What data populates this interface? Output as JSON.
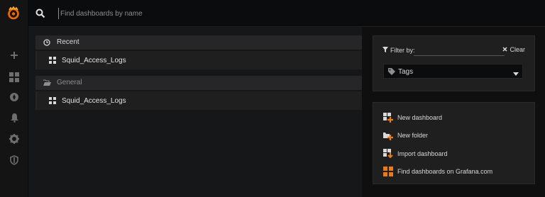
{
  "search": {
    "placeholder": "Find dashboards by name"
  },
  "sidenav": {
    "items": [
      "grafana-logo-icon",
      "plus-icon",
      "grid-icon",
      "compass-icon",
      "bell-icon",
      "gear-icon",
      "shield-icon"
    ]
  },
  "sections": [
    {
      "title": "Recent",
      "icon": "clock-icon",
      "items": [
        "Squid_Access_Logs"
      ]
    },
    {
      "title": "General",
      "icon": "folder-open-icon",
      "items": [
        "Squid_Access_Logs"
      ]
    }
  ],
  "filter": {
    "label": "Filter by:",
    "clear": "Clear",
    "tags_label": "Tags"
  },
  "actions": [
    {
      "label": "New dashboard",
      "icon": "new-dashboard-icon"
    },
    {
      "label": "New folder",
      "icon": "new-folder-icon"
    },
    {
      "label": "Import dashboard",
      "icon": "import-dashboard-icon"
    },
    {
      "label": "Find dashboards on Grafana.com",
      "icon": "grafana-com-icon"
    }
  ],
  "colors": {
    "accent": "#eb7b18",
    "background": "#161719",
    "panel": "#1f1f20"
  }
}
